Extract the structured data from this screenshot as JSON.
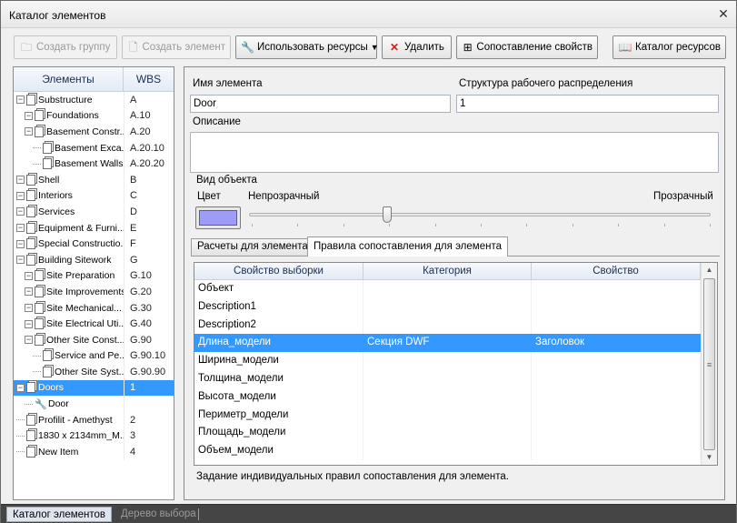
{
  "window": {
    "title": "Каталог элементов",
    "close_glyph": "✕"
  },
  "toolbar": {
    "create_group": "Создать группу",
    "create_element": "Создать элемент",
    "use_resources": "Использовать ресурсы",
    "delete": "Удалить",
    "property_mapping": "Сопоставление свойств",
    "resource_catalog": "Каталог ресурсов"
  },
  "tree": {
    "col_elements": "Элементы",
    "col_wbs": "WBS",
    "rows": [
      {
        "label": "Substructure",
        "wbs": "A"
      },
      {
        "label": "Foundations",
        "wbs": "A.10"
      },
      {
        "label": "Basement Constr...",
        "wbs": "A.20"
      },
      {
        "label": "Basement Exca...",
        "wbs": "A.20.10"
      },
      {
        "label": "Basement Walls",
        "wbs": "A.20.20"
      },
      {
        "label": "Shell",
        "wbs": "B"
      },
      {
        "label": "Interiors",
        "wbs": "C"
      },
      {
        "label": "Services",
        "wbs": "D"
      },
      {
        "label": "Equipment & Furni...",
        "wbs": "E"
      },
      {
        "label": "Special Constructio...",
        "wbs": "F"
      },
      {
        "label": "Building Sitework",
        "wbs": "G"
      },
      {
        "label": "Site Preparation",
        "wbs": "G.10"
      },
      {
        "label": "Site Improvements",
        "wbs": "G.20"
      },
      {
        "label": "Site Mechanical...",
        "wbs": "G.30"
      },
      {
        "label": "Site Electrical Uti...",
        "wbs": "G.40"
      },
      {
        "label": "Other Site Const...",
        "wbs": "G.90"
      },
      {
        "label": "Service and Pe...",
        "wbs": "G.90.10"
      },
      {
        "label": "Other Site Syst...",
        "wbs": "G.90.90"
      },
      {
        "label": "Doors",
        "wbs": "1"
      },
      {
        "label": "Door",
        "wbs": ""
      },
      {
        "label": "Profilit - Amethyst",
        "wbs": "2"
      },
      {
        "label": "1830 x 2134mm_M...",
        "wbs": "3"
      },
      {
        "label": "New Item",
        "wbs": "4"
      }
    ]
  },
  "details": {
    "name_label": "Имя элемента",
    "name_value": "Door",
    "wbs_label": "Структура рабочего распределения",
    "wbs_value": "1",
    "description_label": "Описание",
    "description_value": "",
    "appearance_title": "Вид объекта",
    "color_label": "Цвет",
    "color_value": "#9d9df5",
    "opaque_label": "Непрозрачный",
    "transparent_label": "Прозрачный",
    "transparency": 0.3
  },
  "tabs": {
    "calc": "Расчеты для элемента",
    "rules": "Правила сопоставления для элемента"
  },
  "rules": {
    "headers": [
      "Свойство выборки",
      "Категория",
      "Свойство"
    ],
    "rows": [
      [
        "Объект",
        "",
        ""
      ],
      [
        "Description1",
        "",
        ""
      ],
      [
        "Description2",
        "",
        ""
      ],
      [
        "Длина_модели",
        "Секция DWF",
        "Заголовок"
      ],
      [
        "Ширина_модели",
        "",
        ""
      ],
      [
        "Толщина_модели",
        "",
        ""
      ],
      [
        "Высота_модели",
        "",
        ""
      ],
      [
        "Периметр_модели",
        "",
        ""
      ],
      [
        "Площадь_модели",
        "",
        ""
      ],
      [
        "Объем_модели",
        "",
        ""
      ]
    ],
    "selected_row": 3
  },
  "hint": "Задание индивидуальных правил сопоставления для элемента.",
  "bottom_tabs": {
    "catalog": "Каталог элементов",
    "selection_tree": "Дерево выбора"
  }
}
